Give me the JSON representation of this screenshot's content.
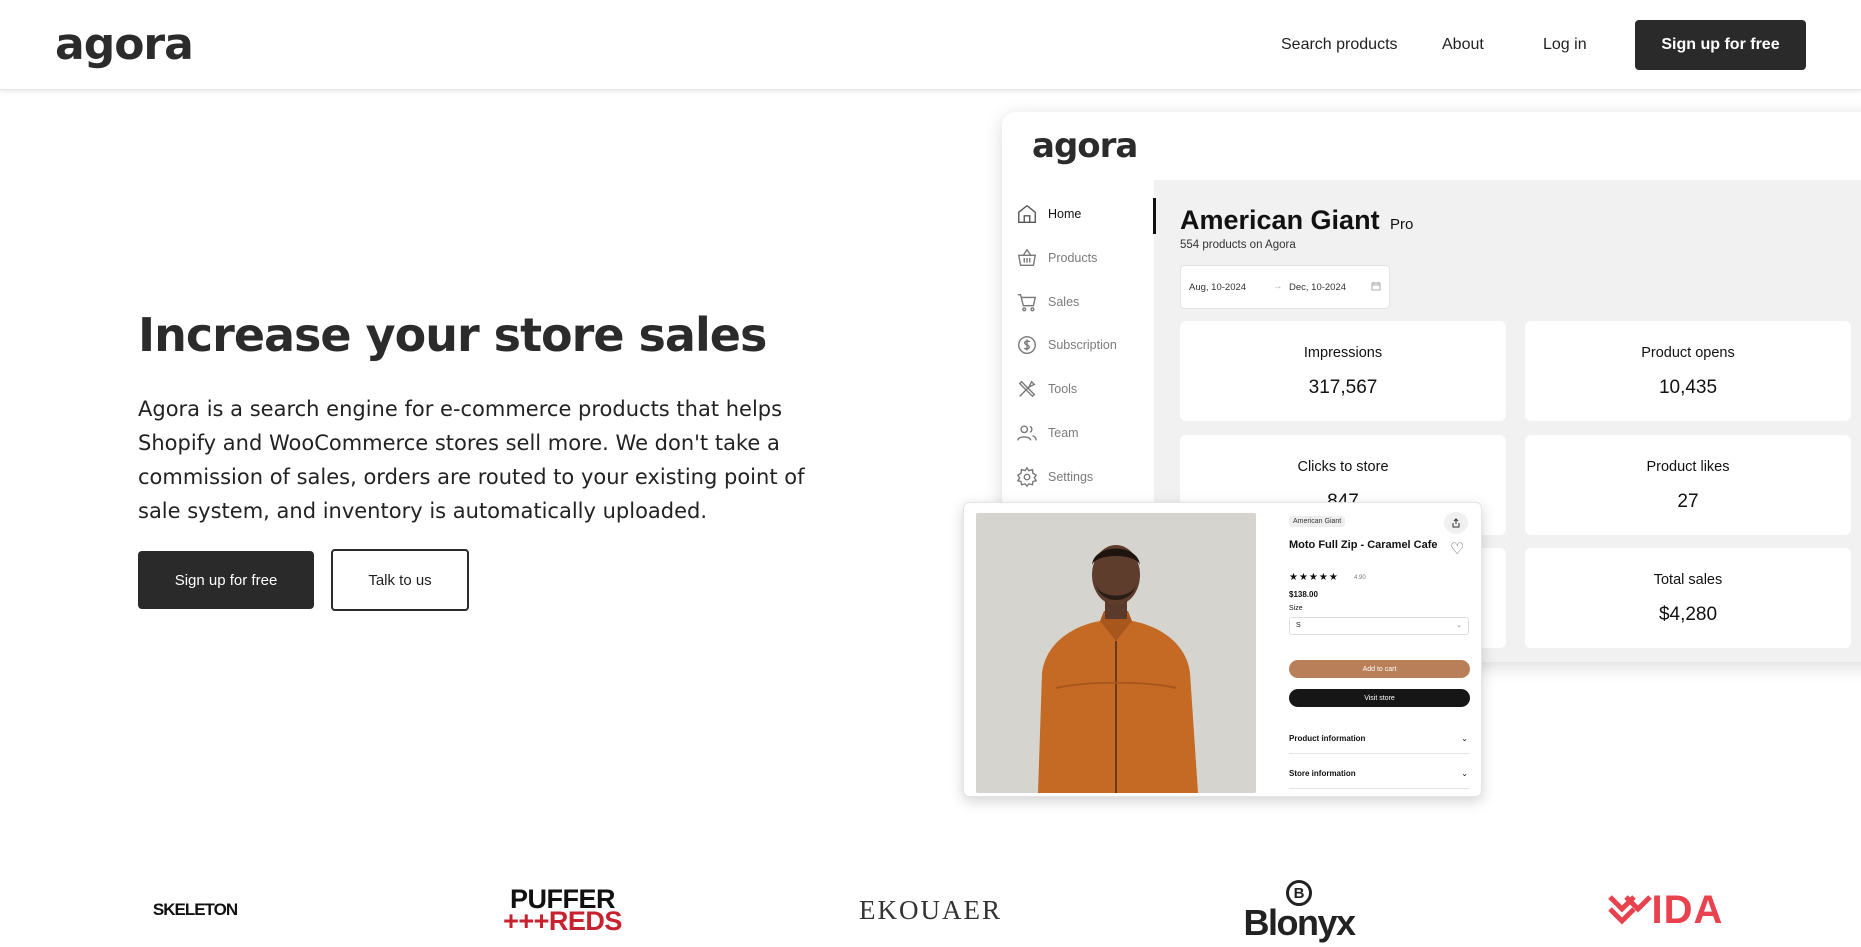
{
  "header": {
    "logo": "agora",
    "nav": {
      "search": "Search products",
      "about": "About",
      "login": "Log in"
    },
    "cta": "Sign up for free"
  },
  "hero": {
    "title": "Increase your store sales",
    "description": "Agora is a search engine for e-commerce products that helps Shopify and WooCommerce stores sell more. We don't take a commission of sales, orders are routed to your existing point of sale system, and inventory is automatically uploaded.",
    "primary_cta": "Sign up for free",
    "secondary_cta": "Talk to us"
  },
  "dashboard": {
    "logo": "agora",
    "sidebar": [
      {
        "label": "Home",
        "icon": "home-icon",
        "active": true
      },
      {
        "label": "Products",
        "icon": "basket-icon"
      },
      {
        "label": "Sales",
        "icon": "cart-icon"
      },
      {
        "label": "Subscription",
        "icon": "dollar-icon"
      },
      {
        "label": "Tools",
        "icon": "tools-icon"
      },
      {
        "label": "Team",
        "icon": "team-icon"
      },
      {
        "label": "Settings",
        "icon": "gear-icon"
      }
    ],
    "store": {
      "name": "American Giant",
      "plan": "Pro",
      "subtitle": "554 products on Agora"
    },
    "date_range": {
      "from": "Aug, 10-2024",
      "arrow": "→",
      "to": "Dec, 10-2024"
    },
    "stats": [
      {
        "label": "Impressions",
        "value": "317,567"
      },
      {
        "label": "Product opens",
        "value": "10,435"
      },
      {
        "label": "Clicks to store",
        "value": "847"
      },
      {
        "label": "Product likes",
        "value": "27"
      },
      {
        "label": "",
        "value": ""
      },
      {
        "label": "Total sales",
        "value": "$4,280"
      }
    ]
  },
  "product_card": {
    "store_badge": "American Giant",
    "title": "Moto Full Zip - Caramel Cafe",
    "stars": "★★★★★",
    "rating": "4.90",
    "price": "$138.00",
    "size_label": "Size",
    "size_value": "S",
    "add_to_cart": "Add to cart",
    "visit_store": "Visit store",
    "product_info": "Product information",
    "store_info": "Store information",
    "accent_color": "#b97f58"
  },
  "brands": {
    "skeleton": "SKELETON",
    "puffer_line1": "PUFFER",
    "puffer_line2": "+++REDS",
    "ekouaer": "EKOUAER",
    "blonyx_badge": "B",
    "blonyx": "Blonyx",
    "ida": "IDA"
  }
}
